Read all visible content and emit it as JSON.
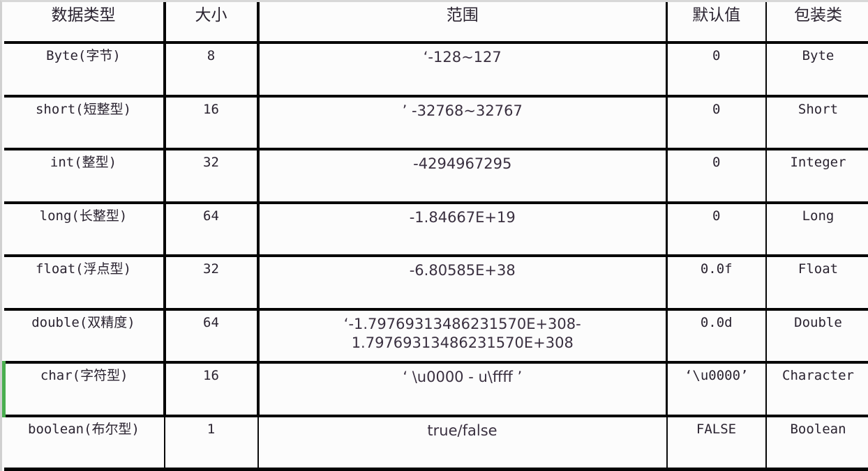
{
  "table": {
    "accent_marker_color": "#4aaf4f",
    "grid_color": "#050505",
    "background_color": "#fcfcfc",
    "text_color": "#2a2330",
    "headers": [
      {
        "key": "type",
        "label": "数据类型"
      },
      {
        "key": "size",
        "label": "大小"
      },
      {
        "key": "range",
        "label": "范围"
      },
      {
        "key": "def",
        "label": "默认值"
      },
      {
        "key": "wrap",
        "label": "包装类"
      }
    ],
    "rows": [
      {
        "type": "Byte(字节)",
        "size": "8",
        "range": "‘-128~127",
        "def": "0",
        "wrap": "Byte",
        "marked": false
      },
      {
        "type": "short(短整型)",
        "size": "16",
        "range": "’ -32768~32767",
        "def": "0",
        "wrap": "Short",
        "marked": false
      },
      {
        "type": "int(整型)",
        "size": "32",
        "range": "-4294967295",
        "def": "0",
        "wrap": "Integer",
        "marked": false
      },
      {
        "type": "long(长整型)",
        "size": "64",
        "range": "-1.84667E+19",
        "def": "0",
        "wrap": "Long",
        "marked": false
      },
      {
        "type": "float(浮点型)",
        "size": "32",
        "range": "-6.80585E+38",
        "def": "0.0f",
        "wrap": "Float",
        "marked": false
      },
      {
        "type": "double(双精度)",
        "size": "64",
        "range": "‘-1.79769313486231570E+308-1.79769313486231570E+308",
        "def": "0.0d",
        "wrap": "Double",
        "marked": false
      },
      {
        "type": "char(字符型)",
        "size": "16",
        "range": "‘ \\u0000 - u\\ffff ’",
        "def": "‘\\u0000’",
        "wrap": "Character",
        "marked": true
      },
      {
        "type": "boolean(布尔型)",
        "size": "1",
        "range": "true/false",
        "def": "FALSE",
        "wrap": "Boolean",
        "marked": false
      }
    ]
  }
}
